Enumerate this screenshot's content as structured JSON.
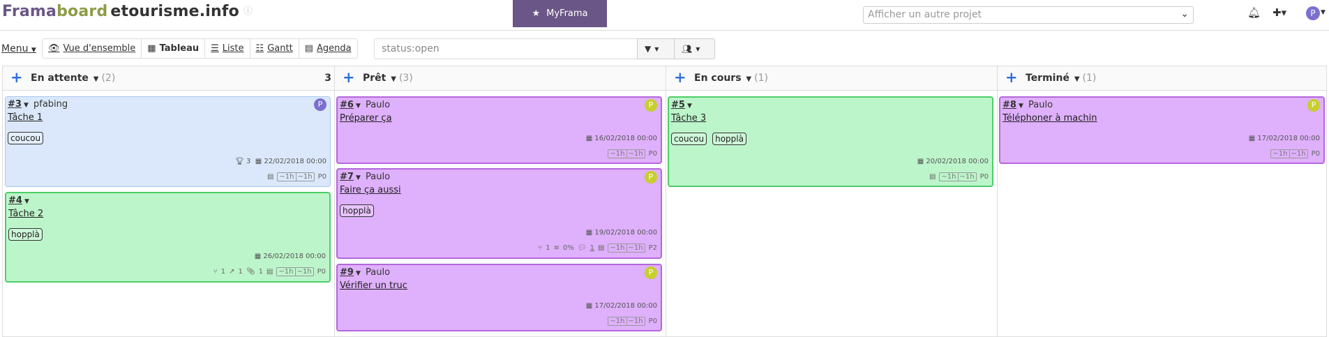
{
  "header": {
    "logo_part1": "Frama",
    "logo_part2": "board",
    "project_name": "etourisme.info",
    "info_icon": "info-circle-icon",
    "myframa_label": "MyFrama",
    "project_selector_placeholder": "Afficher un autre projet",
    "avatar_letter": "P"
  },
  "toolbar": {
    "menu_label": "Menu",
    "views": [
      {
        "label": "Vue d'ensemble",
        "icon": "eye-icon"
      },
      {
        "label": "Tableau",
        "icon": "th-icon"
      },
      {
        "label": "Liste",
        "icon": "list-icon"
      },
      {
        "label": "Gantt",
        "icon": "sliders-icon"
      },
      {
        "label": "Agenda",
        "icon": "calendar-icon"
      }
    ],
    "active_view": "Tableau",
    "filter_value": "status:open"
  },
  "columns": [
    {
      "title": "En attente",
      "count": "(2)",
      "total": "3",
      "cards": [
        {
          "id": "#3",
          "owner": "pfabing",
          "avatar": "P",
          "title": "Tâche 1",
          "tags": [
            "coucou"
          ],
          "date": "22/02/2018 00:00",
          "score": "3",
          "estimate": [
            "~1h",
            "~1h"
          ],
          "priority": "P0",
          "meta": {}
        },
        {
          "id": "#4",
          "owner": "",
          "avatar": "",
          "title": "Tâche 2",
          "tags": [
            "hopplà"
          ],
          "date": "26/02/2018 00:00",
          "estimate": [
            "~1h",
            "~1h"
          ],
          "priority": "P0",
          "meta": {
            "subtasks": "1",
            "links": "1",
            "attachments": "1"
          }
        }
      ]
    },
    {
      "title": "Prêt",
      "count": "(3)",
      "cards": [
        {
          "id": "#6",
          "owner": "Paulo",
          "avatar": "P",
          "title": "Préparer ça",
          "tags": [],
          "date": "16/02/2018 00:00",
          "estimate": [
            "~1h",
            "~1h"
          ],
          "priority": "P0"
        },
        {
          "id": "#7",
          "owner": "Paulo",
          "avatar": "P",
          "title": "Faire ça aussi",
          "tags": [
            "hopplà"
          ],
          "date": "19/02/2018 00:00",
          "estimate": [
            "~1h",
            "~1h"
          ],
          "priority": "P2",
          "meta": {
            "subtasks": "1",
            "progress": "0%",
            "comments": "1"
          }
        },
        {
          "id": "#9",
          "owner": "Paulo",
          "avatar": "P",
          "title": "Vérifier un truc",
          "tags": [],
          "date": "17/02/2018 00:00",
          "estimate": [
            "~1h",
            "~1h"
          ],
          "priority": "P0"
        }
      ]
    },
    {
      "title": "En cours",
      "count": "(1)",
      "cards": [
        {
          "id": "#5",
          "owner": "",
          "avatar": "",
          "title": "Tâche 3",
          "tags": [
            "coucou",
            "hopplà"
          ],
          "date": "20/02/2018 00:00",
          "estimate": [
            "~1h",
            "~1h"
          ],
          "priority": "P0"
        }
      ]
    },
    {
      "title": "Terminé",
      "count": "(1)",
      "cards": [
        {
          "id": "#8",
          "owner": "Paulo",
          "avatar": "P",
          "title": "Téléphoner à machin",
          "tags": [],
          "date": "17/02/2018 00:00",
          "estimate": [
            "~1h",
            "~1h"
          ],
          "priority": "P0"
        }
      ]
    }
  ],
  "colors": {
    "brand_purple": "#6a5687",
    "brand_green": "#8e9c48",
    "plus_blue": "#3071d6",
    "card_blue": "#dbe8fb",
    "card_green": "#bdf5cb",
    "card_purple": "#dfb0fb"
  }
}
